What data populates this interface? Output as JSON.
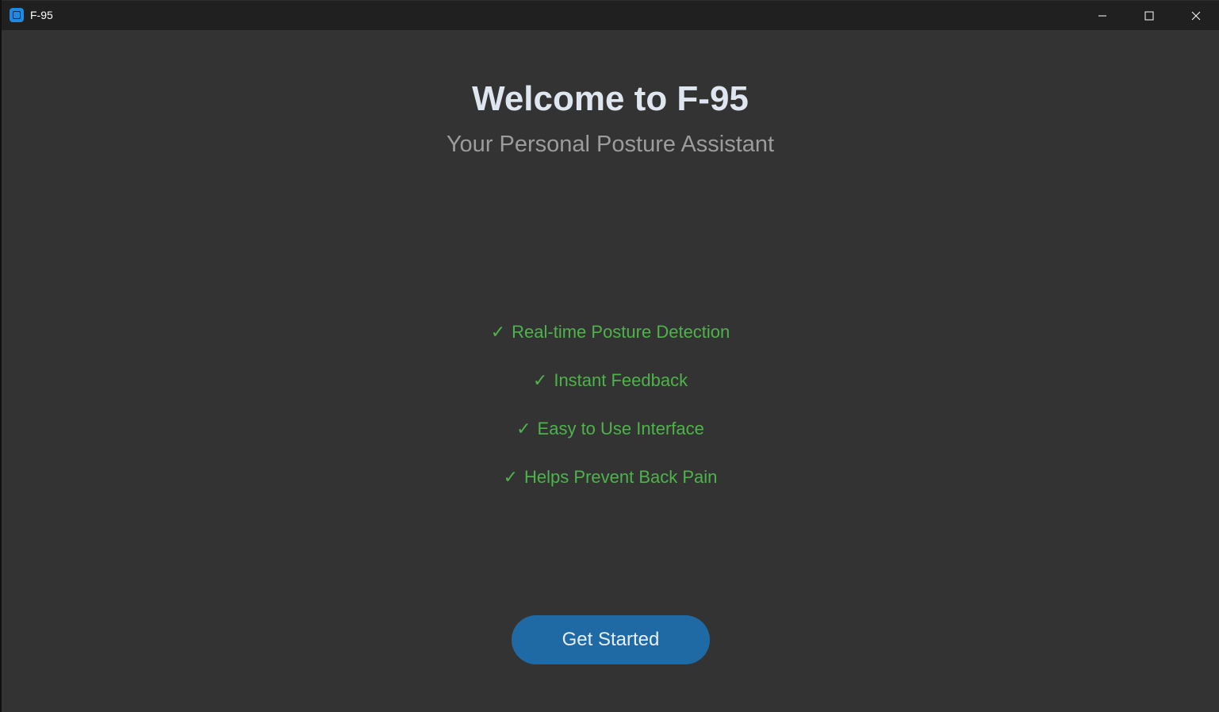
{
  "window": {
    "title": "F-95",
    "controls": {
      "minimize": "minimize-icon",
      "maximize": "maximize-icon",
      "close": "close-icon"
    }
  },
  "welcome": {
    "title": "Welcome to F-95",
    "subtitle": "Your Personal Posture Assistant"
  },
  "features": [
    {
      "check": "✓",
      "label": "Real-time Posture Detection"
    },
    {
      "check": "✓",
      "label": "Instant Feedback"
    },
    {
      "check": "✓",
      "label": "Easy to Use Interface"
    },
    {
      "check": "✓",
      "label": "Helps Prevent Back Pain"
    }
  ],
  "actions": {
    "get_started_label": "Get Started"
  },
  "colors": {
    "background": "#333333",
    "titlebar": "#202020",
    "accent": "#1f6aa5",
    "feature_text": "#4db34a",
    "title_text": "#dfe6f0",
    "subtitle_text": "#9c9c9c"
  }
}
